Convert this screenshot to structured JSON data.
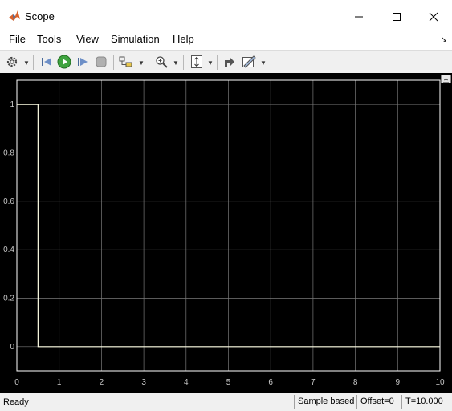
{
  "window": {
    "title": "Scope"
  },
  "menu": [
    "File",
    "Tools",
    "View",
    "Simulation",
    "Help"
  ],
  "toolbar_icons": [
    "gear-icon",
    "step-back-icon",
    "run-icon",
    "step-forward-icon",
    "stop-icon",
    "highlight-block-icon",
    "zoom-icon",
    "autoscale-icon",
    "restore-icon",
    "measurements-icon"
  ],
  "status": {
    "ready": "Ready",
    "sample_based": "Sample based",
    "offset": "Offset=0",
    "time": "T=10.000"
  },
  "colors": {
    "plot_bg": "#000000",
    "axes_border": "#ffffff",
    "grid": "#7a7a7a",
    "signal": "#ffffe6",
    "tick_text": "#c8c8c8"
  },
  "chart_data": {
    "type": "line",
    "xlim": [
      0,
      10
    ],
    "ylim": [
      -0.1,
      1.1
    ],
    "xticks": [
      "0",
      "1",
      "2",
      "3",
      "4",
      "5",
      "6",
      "7",
      "8",
      "9",
      "10"
    ],
    "yticks": [
      "0",
      "0.2",
      "0.4",
      "0.6",
      "0.8",
      "1"
    ],
    "grid": true,
    "series": [
      {
        "x": [
          0,
          0.5,
          0.5,
          10
        ],
        "y": [
          1,
          1,
          0,
          0
        ]
      }
    ]
  }
}
